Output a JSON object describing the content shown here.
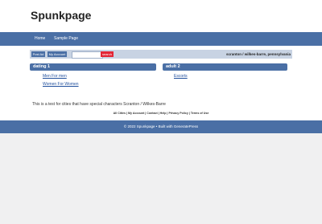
{
  "site": {
    "title": "Spunkpage"
  },
  "nav": {
    "items": [
      {
        "label": "Home"
      },
      {
        "label": "Sample Page"
      }
    ]
  },
  "toolbar": {
    "post_ad_label": "Post Ad",
    "my_account_label": "My Account",
    "search_placeholder": "",
    "search_label": "search",
    "location": "scranton / wilkes-barre, pennsylvania"
  },
  "categories": [
    {
      "title": "dating 1",
      "links": [
        "Men For men",
        "Women For Women"
      ]
    },
    {
      "title": "adult 2",
      "links": [
        "Escorts"
      ]
    }
  ],
  "note": "This is a test for cities that have special characters Scranton / Wilkes-Barre",
  "footer_links": "All Cities | My Account | Contact | Help | Privacy Policy | Terms of Use",
  "footer": {
    "copyright": "© 2022 Spunkpage • Built with GeneratePress"
  },
  "colors": {
    "nav": "#4a6fa5",
    "search": "#e32636",
    "toolbar": "#c8d3e3"
  }
}
